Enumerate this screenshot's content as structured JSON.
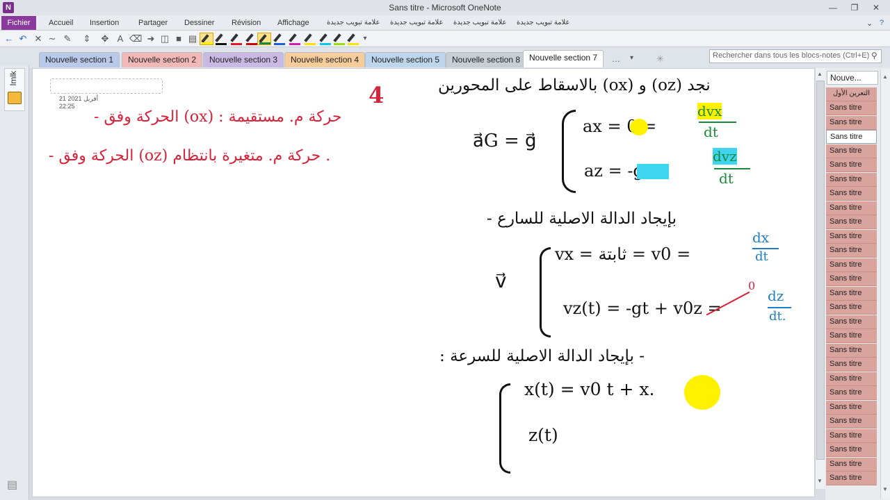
{
  "window": {
    "title": "Sans titre  -  Microsoft OneNote",
    "app_letter": "N"
  },
  "ribbon": {
    "file_tab": "Fichier",
    "tabs": [
      "Accueil",
      "Insertion",
      "Partager",
      "Dessiner",
      "Révision",
      "Affichage",
      "علامة تبويب جديدة",
      "علامة تبويب جديدة",
      "علامة تبويب جديدة",
      "علامة تبويب جديدة"
    ]
  },
  "section_tabs": [
    {
      "label": "Nouvelle section 1",
      "color": "#b9c9ea"
    },
    {
      "label": "Nouvelle section 2",
      "color": "#f2b8b8"
    },
    {
      "label": "Nouvelle section 3",
      "color": "#c9b9e4"
    },
    {
      "label": "Nouvelle section 4",
      "color": "#f6cc9a"
    },
    {
      "label": "Nouvelle section 5",
      "color": "#bdd6ec"
    },
    {
      "label": "Nouvelle section 8",
      "color": "#c8ced6"
    },
    {
      "label": "Nouvelle section 7",
      "color": "#ffffff",
      "active": true
    }
  ],
  "search": {
    "placeholder": "Rechercher dans tous les blocs-notes (Ctrl+E)"
  },
  "notebook": {
    "name": "lmlk"
  },
  "page": {
    "date": "21 أفريل 2021",
    "time": "22:25"
  },
  "pages_panel": {
    "header": "Nouve...",
    "first_item": "التعرين الأول",
    "items": [
      "Sans titre",
      "Sans titre",
      "Sans titre",
      "Sans titre",
      "Sans titre",
      "Sans titre",
      "Sans titre",
      "Sans titre",
      "Sans titre",
      "Sans titre",
      "Sans titre",
      "Sans titre",
      "Sans titre",
      "Sans titre",
      "Sans titre",
      "Sans titre",
      "Sans titre",
      "Sans titre",
      "Sans titre",
      "Sans titre",
      "Sans titre",
      "Sans titre",
      "Sans titre",
      "Sans titre",
      "Sans titre",
      "Sans titre",
      "Sans titre"
    ],
    "active_index": 2
  },
  "notes": {
    "left_line1": "- الحركة وفق (ox) : حركة م. مستقيمة",
    "left_line2": "- الحركة وفق (oz) حركة م. متغيرة بانتظام .",
    "mark": "4",
    "header": "بالاسقاط على المحورين (ox) و (oz) نجد",
    "acc_vec": "a⃗G = g⃗",
    "ax": "ax = 0 =",
    "ax_frac": [
      "dvx",
      "dt"
    ],
    "az": "az = -g =",
    "az_frac": [
      "dvz",
      "dt"
    ],
    "vel_header": "- بإيجاد الدالة الاصلية للسارع",
    "v_vec": "v⃗",
    "vx": "vx = ثابتة = v0 =",
    "vx_frac": [
      "dx",
      "dt"
    ],
    "vz": "vz(t) = -gt + v0z =",
    "vz_zero": "0",
    "vz_frac": [
      "dz",
      "dt."
    ],
    "pos_header": ": بإيجاد الدالة الاصلية للسرعة -",
    "x_eq": "x(t) = v0 t + x.",
    "z_eq": "z(t)"
  },
  "colors": {
    "accent": "#8a3a9c",
    "ink_red": "#d6233a",
    "ink_blue": "#1f7fc4",
    "ink_green": "#1a8a3a",
    "highlight_yellow": "#fff100",
    "highlight_cyan": "#3fd4f0"
  }
}
